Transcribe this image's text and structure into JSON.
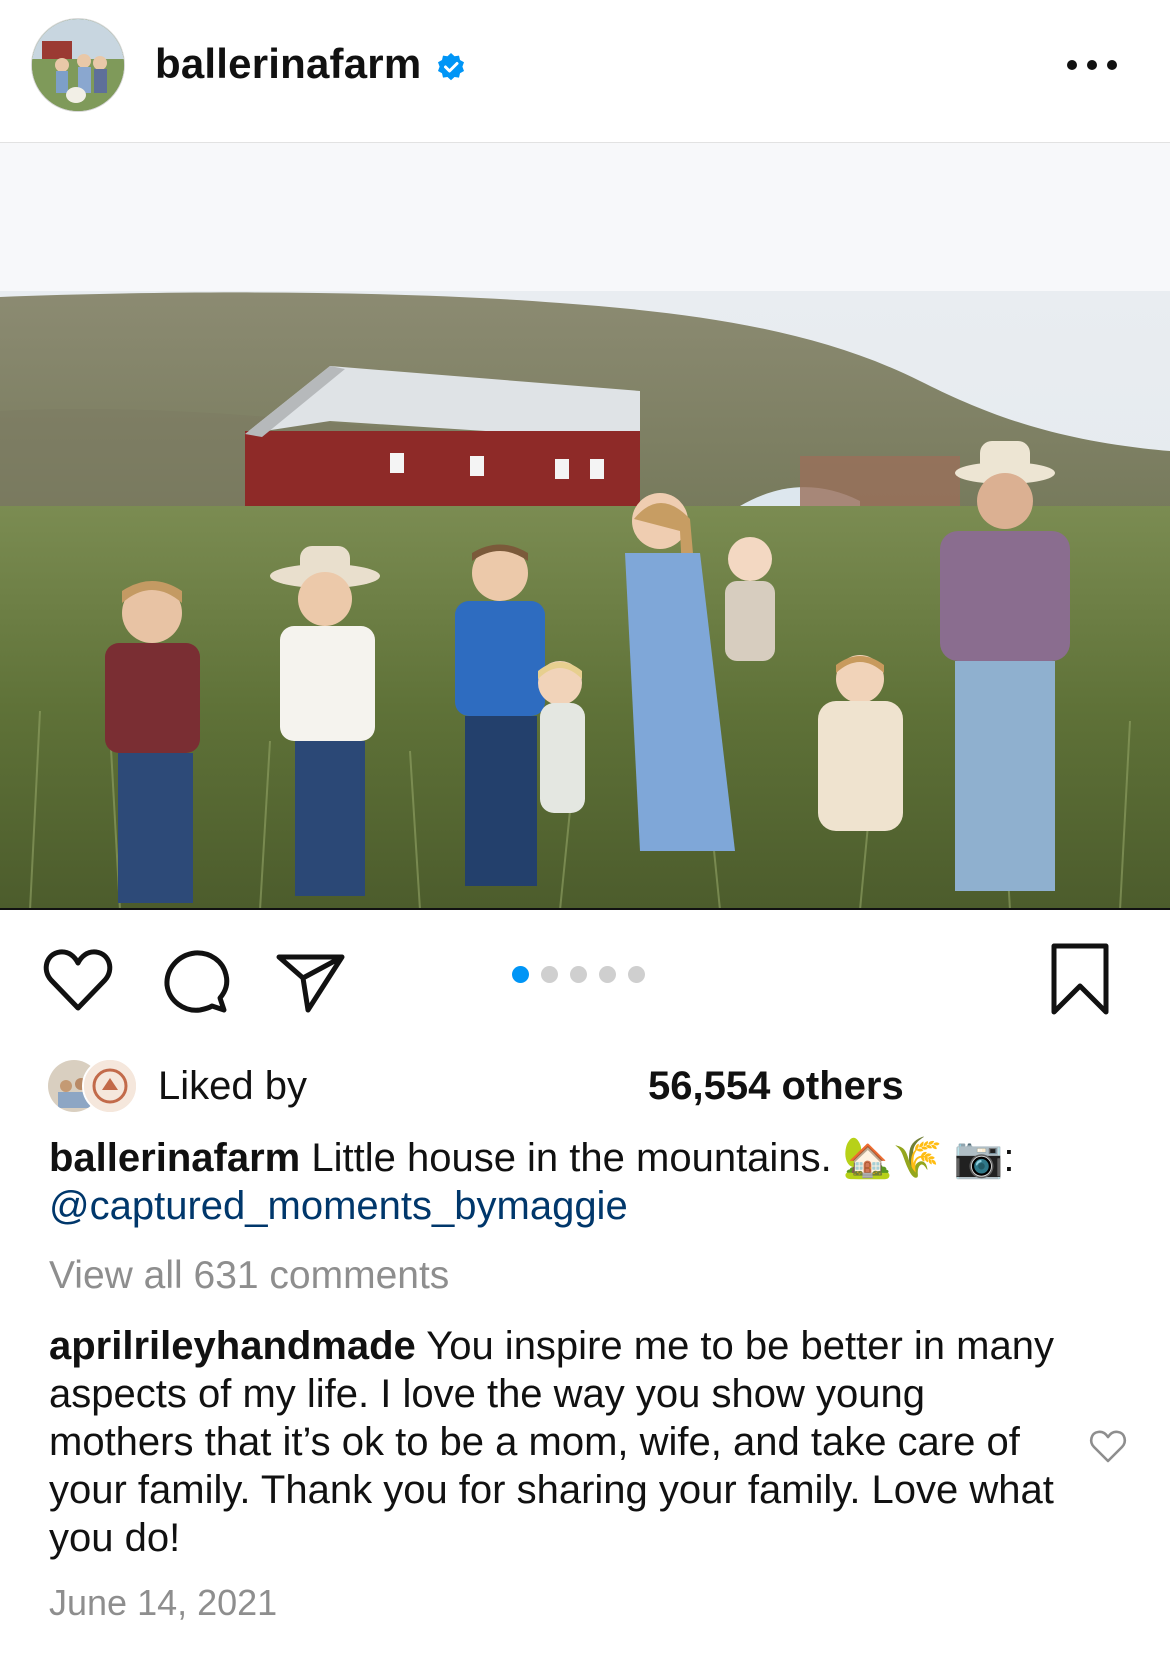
{
  "post": {
    "username": "ballerinafarm",
    "verified": true,
    "more_icon": "more-horizontal-icon",
    "carousel": {
      "count": 5,
      "active_index": 0
    },
    "likes_prefix": "Liked by",
    "likes_count": "56,554 others",
    "caption": {
      "username": "ballerinafarm",
      "text": "Little house in the mountains. 🏡🌾 📷:",
      "mention": "@captured_moments_bymaggie"
    },
    "view_all_comments": "View all 631 comments",
    "top_comment": {
      "username": "aprilrileyhandmade",
      "text": "You inspire me to be better in many aspects of my life. I love the way you show young mothers that it’s ok to be a mom, wife, and take care of your family. Thank you for sharing your family. Love what you do!"
    },
    "date": "June 14, 2021"
  },
  "colors": {
    "accent": "#0095f6",
    "mention": "#00376b",
    "muted": "#8e8e8e",
    "barn": "#8e2a28"
  }
}
